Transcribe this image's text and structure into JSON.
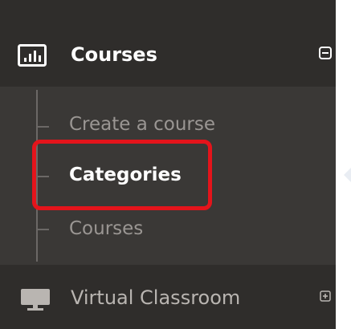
{
  "sidebar": {
    "section": {
      "label": "Courses",
      "icon": "bar-chart-icon",
      "toggle_icon": "collapse-minus-icon"
    },
    "submenu": {
      "items": [
        {
          "label": "Create a course",
          "active": false
        },
        {
          "label": "Categories",
          "active": true
        },
        {
          "label": "Courses",
          "active": false
        }
      ]
    },
    "next_section": {
      "label": "Virtual Classroom",
      "icon": "monitor-icon",
      "toggle_icon": "expand-plus-icon"
    }
  },
  "annotation": {
    "highlight_color": "#e4141b"
  },
  "colors": {
    "sidebar_bg": "#2f2d2b",
    "submenu_bg": "#3a3836",
    "active_text": "#ffffff",
    "inactive_text": "#9a9693"
  }
}
